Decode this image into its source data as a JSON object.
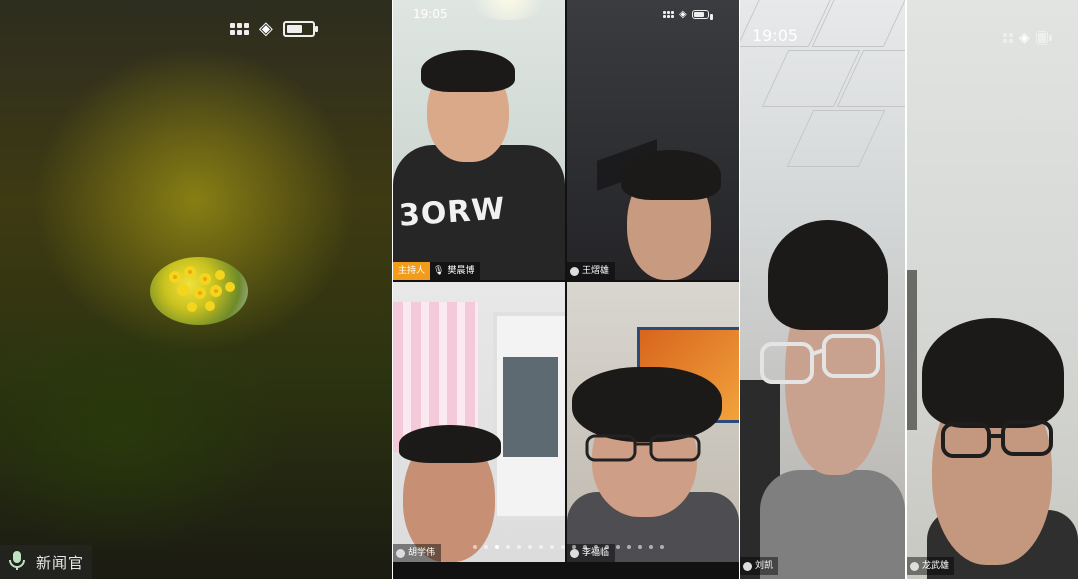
{
  "panel1": {
    "participant_name": "新闻官",
    "icons": {
      "signal": "cellular-signal-icon",
      "wifi": "wifi-icon",
      "battery": "battery-icon",
      "mic": "microphone-icon"
    },
    "avatar": "flower-avatar"
  },
  "panel2": {
    "time": "19:05",
    "host_tag": "主持人",
    "tiles": [
      {
        "name": "樊晨博",
        "shirt_text": "3ORW"
      },
      {
        "name": "王熠雄"
      },
      {
        "name": "胡学伟"
      },
      {
        "name": "李福临"
      }
    ],
    "page_dots": 8,
    "active_dot": 2
  },
  "panel3": {
    "time": "19:05",
    "name": "刘凯"
  },
  "panel4": {
    "name": "龙武雄"
  },
  "colors": {
    "host_tag": "#f29c1c",
    "background": "#000000"
  }
}
